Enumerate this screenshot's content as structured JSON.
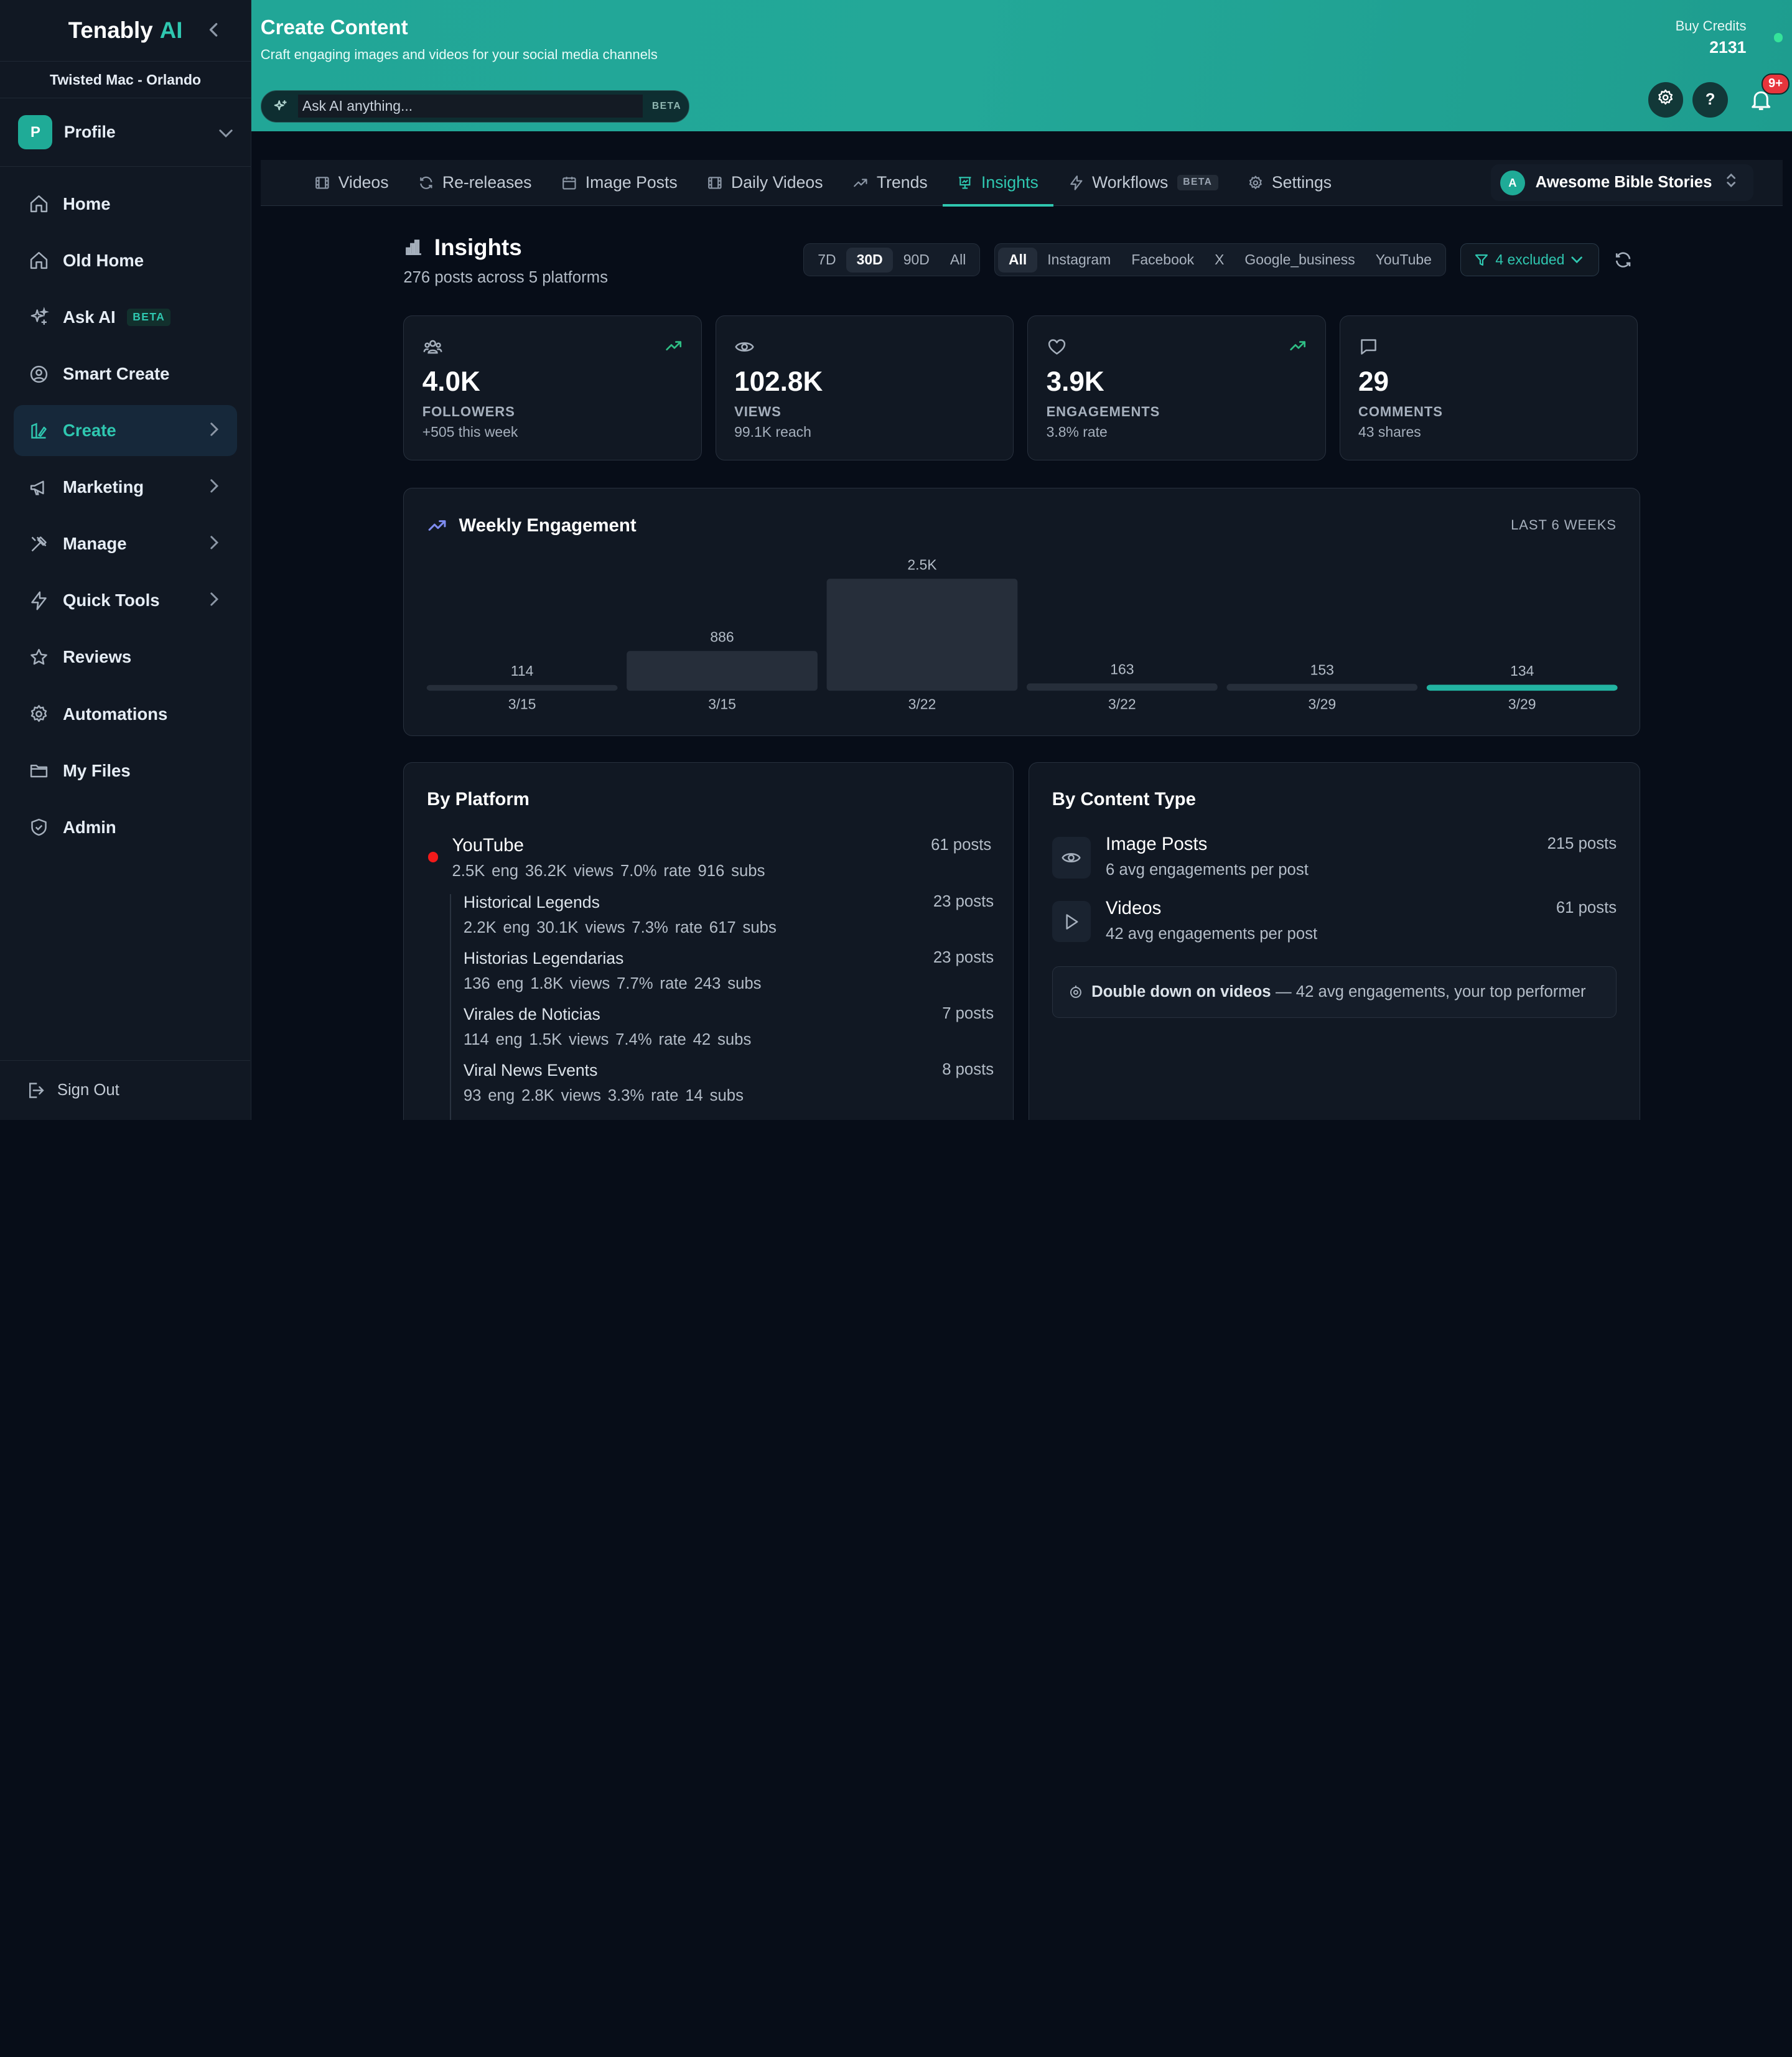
{
  "sidebar": {
    "brand": "Tenably",
    "brand_ai": "AI",
    "org": "Twisted Mac - Orlando",
    "profile": {
      "initial": "P",
      "label": "Profile"
    },
    "items": [
      {
        "label": "Home"
      },
      {
        "label": "Old Home"
      },
      {
        "label": "Ask AI",
        "badge": "BETA"
      },
      {
        "label": "Smart Create"
      },
      {
        "label": "Create"
      },
      {
        "label": "Marketing"
      },
      {
        "label": "Manage"
      },
      {
        "label": "Quick Tools"
      },
      {
        "label": "Reviews"
      },
      {
        "label": "Automations"
      },
      {
        "label": "My Files"
      },
      {
        "label": "Admin"
      }
    ],
    "signout": "Sign Out"
  },
  "header": {
    "title": "Create Content",
    "subtitle": "Craft engaging images and videos for your social media channels",
    "ask_placeholder": "Ask AI anything...",
    "ask_badge": "BETA",
    "credits_label": "Buy Credits",
    "credits_value": "2131",
    "help": "?",
    "notifications": "9+"
  },
  "tabs": [
    {
      "label": "Videos"
    },
    {
      "label": "Re-releases"
    },
    {
      "label": "Image Posts"
    },
    {
      "label": "Daily Videos"
    },
    {
      "label": "Trends"
    },
    {
      "label": "Insights"
    },
    {
      "label": "Workflows",
      "badge": "BETA"
    },
    {
      "label": "Settings"
    }
  ],
  "channel": {
    "initial": "A",
    "name": "Awesome Bible Stories"
  },
  "insights": {
    "title": "Insights",
    "subtitle": "276 posts across 5 platforms",
    "time_ranges": [
      "7D",
      "30D",
      "90D",
      "All"
    ],
    "selected_time_range": "30D",
    "platforms": [
      "All",
      "Instagram",
      "Facebook",
      "X",
      "Google_business",
      "YouTube"
    ],
    "selected_platform": "All",
    "filter": "4 excluded"
  },
  "stats": [
    {
      "value": "4.0K",
      "label": "FOLLOWERS",
      "sub": "+505 this week"
    },
    {
      "value": "102.8K",
      "label": "VIEWS",
      "sub": "99.1K reach"
    },
    {
      "value": "3.9K",
      "label": "ENGAGEMENTS",
      "sub": "3.8% rate"
    },
    {
      "value": "29",
      "label": "COMMENTS",
      "sub": "43 shares"
    }
  ],
  "weekly": {
    "title": "Weekly Engagement",
    "range": "LAST 6 WEEKS",
    "colors": {
      "bar": "#262e3a",
      "highlight": "#22b3a1"
    }
  },
  "chart_data": {
    "type": "bar",
    "title": "Weekly Engagement",
    "categories": [
      "3/15",
      "3/15",
      "3/22",
      "3/22",
      "3/29",
      "3/29"
    ],
    "values": [
      114,
      886,
      2500,
      163,
      153,
      134
    ],
    "value_labels": [
      "114",
      "886",
      "2.5K",
      "163",
      "153",
      "134"
    ],
    "highlight_index": 5
  },
  "by_platform": {
    "title": "By Platform",
    "platform": {
      "name": "YouTube",
      "posts": "61 posts",
      "stats": "2.5K eng   36.2K views   7.0% rate   916 subs",
      "color": "#f21a1a"
    },
    "channels": [
      {
        "name": "Historical Legends",
        "stats": "2.2K eng   30.1K views   7.3% rate   617 subs",
        "posts": "23 posts"
      },
      {
        "name": "Historias Legendarias",
        "stats": "136 eng   1.8K views   7.7% rate   243 subs",
        "posts": "23 posts"
      },
      {
        "name": "Virales de Noticias",
        "stats": "114 eng   1.5K views   7.4% rate   42 subs",
        "posts": "7 posts"
      },
      {
        "name": "Viral News Events",
        "stats": "93 eng   2.8K views   3.3% rate   14 subs",
        "posts": "8 posts"
      }
    ]
  },
  "by_content_type": {
    "title": "By Content Type",
    "rows": [
      {
        "name": "Image Posts",
        "sub": "6 avg engagements per post",
        "posts": "215 posts",
        "icon": "eye-icon"
      },
      {
        "name": "Videos",
        "sub": "42 avg engagements per post",
        "posts": "61 posts",
        "icon": "play-icon"
      }
    ],
    "tip_bold": "Double down on videos",
    "tip_text": "— 42 avg engagements, your top performer"
  }
}
